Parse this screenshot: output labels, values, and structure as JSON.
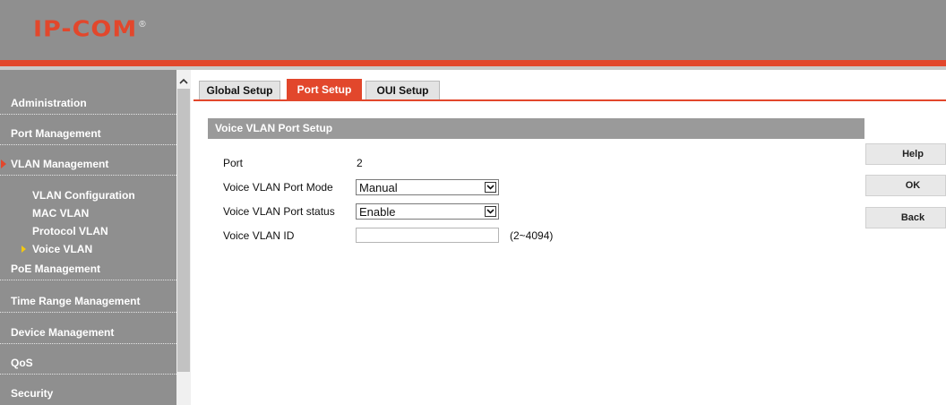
{
  "header": {
    "logo_text": "IP-COM",
    "logo_mark": "®"
  },
  "sidebar": {
    "items": [
      {
        "label": "Administration"
      },
      {
        "label": "Port Management"
      },
      {
        "label": "VLAN Management"
      },
      {
        "label": "PoE Management"
      },
      {
        "label": "Time Range Management"
      },
      {
        "label": "Device Management"
      },
      {
        "label": "QoS"
      },
      {
        "label": "Security"
      }
    ],
    "sub_items": [
      {
        "label": "VLAN Configuration"
      },
      {
        "label": "MAC VLAN"
      },
      {
        "label": "Protocol VLAN"
      },
      {
        "label": "Voice VLAN"
      }
    ]
  },
  "tabs": [
    {
      "label": "Global Setup"
    },
    {
      "label": "Port Setup"
    },
    {
      "label": "OUI Setup"
    }
  ],
  "section": {
    "title": "Voice VLAN Port Setup",
    "port_label": "Port",
    "port_value": "2",
    "mode_label": "Voice VLAN Port Mode",
    "mode_value": "Manual",
    "status_label": "Voice VLAN Port status",
    "status_value": "Enable",
    "vlan_id_label": "Voice VLAN ID",
    "vlan_id_value": "",
    "vlan_id_range": "(2~4094)"
  },
  "buttons": {
    "help": "Help",
    "ok": "OK",
    "back": "Back"
  },
  "colors": {
    "accent": "#e2472c",
    "sidebar_bg": "#8f8f8f",
    "section_bg": "#9a9a9a",
    "pointer": "#f2c811"
  }
}
